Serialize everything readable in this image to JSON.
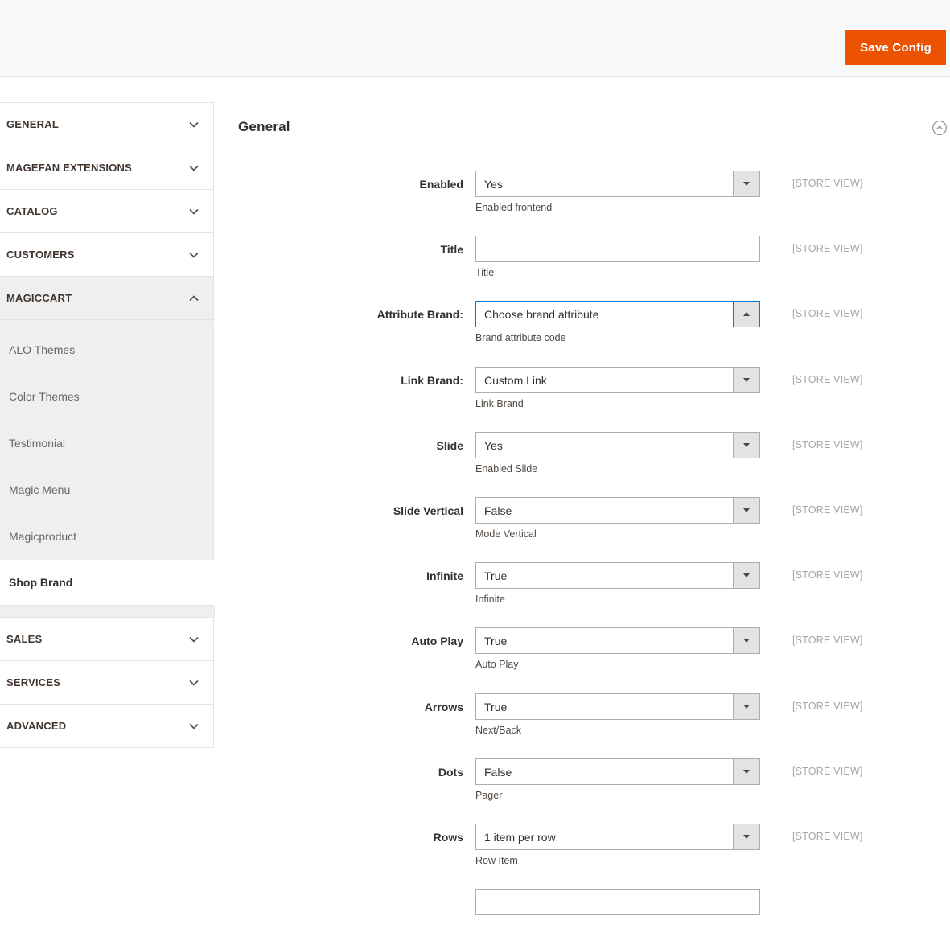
{
  "header": {
    "save_button_label": "Save Config"
  },
  "panel": {
    "title": "General"
  },
  "sidebar": {
    "sections": [
      {
        "label": "GENERAL",
        "state": "collapsed"
      },
      {
        "label": "MAGEFAN EXTENSIONS",
        "state": "collapsed"
      },
      {
        "label": "CATALOG",
        "state": "collapsed"
      },
      {
        "label": "CUSTOMERS",
        "state": "collapsed"
      },
      {
        "label": "MAGICCART",
        "state": "expanded",
        "children": [
          {
            "label": "ALO Themes",
            "active": false
          },
          {
            "label": "Color Themes",
            "active": false
          },
          {
            "label": "Testimonial",
            "active": false
          },
          {
            "label": "Magic Menu",
            "active": false
          },
          {
            "label": "Magicproduct",
            "active": false
          },
          {
            "label": "Shop Brand",
            "active": true
          }
        ]
      },
      {
        "label": "SALES",
        "state": "collapsed"
      },
      {
        "label": "SERVICES",
        "state": "collapsed"
      },
      {
        "label": "ADVANCED",
        "state": "collapsed"
      }
    ]
  },
  "form": {
    "fields": [
      {
        "label": "Enabled",
        "type": "select",
        "value": "Yes",
        "note": "Enabled frontend",
        "scope": "[STORE VIEW]",
        "focused": false,
        "open": false
      },
      {
        "label": "Title",
        "type": "text",
        "value": "",
        "note": "Title",
        "scope": "[STORE VIEW]",
        "focused": false,
        "open": false
      },
      {
        "label": "Attribute Brand:",
        "type": "select",
        "value": "Choose brand attribute",
        "note": "Brand attribute code",
        "scope": "[STORE VIEW]",
        "focused": true,
        "open": true
      },
      {
        "label": "Link Brand:",
        "type": "select",
        "value": "Custom Link",
        "note": "Link Brand",
        "scope": "[STORE VIEW]",
        "focused": false,
        "open": false
      },
      {
        "label": "Slide",
        "type": "select",
        "value": "Yes",
        "note": "Enabled Slide",
        "scope": "[STORE VIEW]",
        "focused": false,
        "open": false
      },
      {
        "label": "Slide Vertical",
        "type": "select",
        "value": "False",
        "note": "Mode Vertical",
        "scope": "[STORE VIEW]",
        "focused": false,
        "open": false
      },
      {
        "label": "Infinite",
        "type": "select",
        "value": "True",
        "note": "Infinite",
        "scope": "[STORE VIEW]",
        "focused": false,
        "open": false
      },
      {
        "label": "Auto Play",
        "type": "select",
        "value": "True",
        "note": "Auto Play",
        "scope": "[STORE VIEW]",
        "focused": false,
        "open": false
      },
      {
        "label": "Arrows",
        "type": "select",
        "value": "True",
        "note": "Next/Back",
        "scope": "[STORE VIEW]",
        "focused": false,
        "open": false
      },
      {
        "label": "Dots",
        "type": "select",
        "value": "False",
        "note": "Pager",
        "scope": "[STORE VIEW]",
        "focused": false,
        "open": false
      },
      {
        "label": "Rows",
        "type": "select",
        "value": "1 item per row",
        "note": "Row Item",
        "scope": "[STORE VIEW]",
        "focused": false,
        "open": false
      },
      {
        "label": "",
        "type": "text",
        "value": "",
        "note": "",
        "scope": "",
        "focused": false,
        "open": false
      }
    ]
  },
  "icons": {
    "section_collapsed": "chevron-down",
    "section_expanded": "chevron-up",
    "panel_collapse": "chevron-up-circle",
    "select_closed": "triangle-down",
    "select_open": "triangle-up"
  },
  "colors": {
    "accent": "#eb5202",
    "focus_border": "#007bdb",
    "header_bg": "#f8f8f8",
    "sidebar_expanded_bg": "#efefef",
    "border": "#e3e3e3",
    "input_border": "#adadad",
    "scope_text": "#a6a6a6"
  }
}
